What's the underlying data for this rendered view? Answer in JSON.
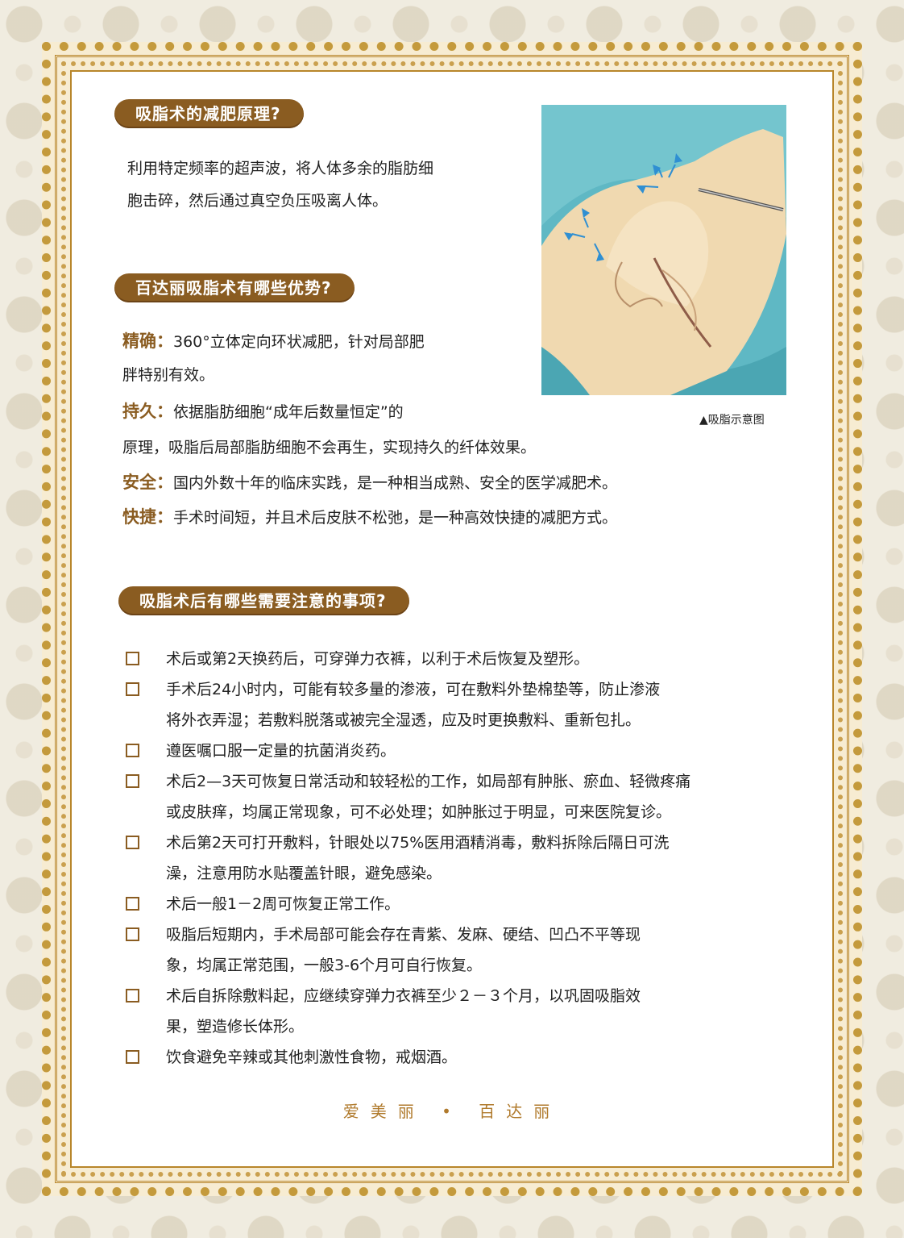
{
  "section1": {
    "title": "吸脂术的减肥原理?",
    "body": [
      "利用特定频率的超声波，将人体多余的脂肪细",
      "胞击碎，然后通过真空负压吸离人体。"
    ]
  },
  "section2": {
    "title": "百达丽吸脂术有哪些优势?",
    "items": [
      {
        "lead": "精确：",
        "lines": [
          "360°立体定向环状减肥，针对局部肥",
          "胖特别有效。"
        ]
      },
      {
        "lead": "持久：",
        "lines": [
          "依据脂肪细胞“成年后数量恒定”的",
          "原理，吸脂后局部脂肪细胞不会再生，实现持久的纤体效果。"
        ]
      },
      {
        "lead": "安全：",
        "lines": [
          "国内外数十年的临床实践，是一种相当成熟、安全的医学减肥术。"
        ]
      },
      {
        "lead": "快捷：",
        "lines": [
          "手术时间短，并且术后皮肤不松弛，是一种高效快捷的减肥方式。"
        ]
      }
    ]
  },
  "image": {
    "caption": "▲吸脂示意图"
  },
  "section3": {
    "title": "吸脂术后有哪些需要注意的事项?",
    "items": [
      "术后或第2天换药后，可穿弹力衣裤，以利于术后恢复及塑形。",
      "手术后24小时内，可能有较多量的渗液，可在敷料外垫棉垫等，防止渗液\n将外衣弄湿；若敷料脱落或被完全湿透，应及时更换敷料、重新包扎。",
      "遵医嘱口服一定量的抗菌消炎药。",
      "术后2—3天可恢复日常活动和较轻松的工作，如局部有肿胀、瘀血、轻微疼痛\n或皮肤痒，均属正常现象，可不必处理；如肿胀过于明显，可来医院复诊。",
      "术后第2天可打开敷料，针眼处以75%医用酒精消毒，敷料拆除后隔日可洗\n澡，注意用防水贴覆盖针眼，避免感染。",
      "术后一般1－2周可恢复正常工作。",
      "吸脂后短期内，手术局部可能会存在青紫、发麻、硬结、凹凸不平等现\n象，均属正常范围，一般3-6个月可自行恢复。",
      "术后自拆除敷料起，应继续穿弹力衣裤至少２－３个月，以巩固吸脂效\n果，塑造修长体形。",
      "饮食避免辛辣或其他刺激性食物，戒烟酒。"
    ]
  },
  "footer": "爱美丽 • 百达丽",
  "colors": {
    "accent": "#8a5c21",
    "gold": "#c49a3c",
    "footer": "#b07a2c"
  }
}
